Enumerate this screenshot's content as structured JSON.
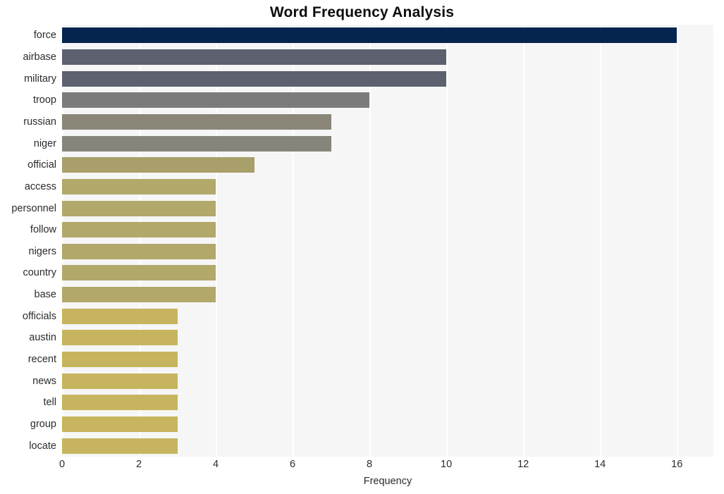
{
  "chart_data": {
    "type": "bar",
    "orientation": "horizontal",
    "title": "Word Frequency Analysis",
    "xlabel": "Frequency",
    "ylabel": "",
    "categories": [
      "force",
      "airbase",
      "military",
      "troop",
      "russian",
      "niger",
      "official",
      "access",
      "personnel",
      "follow",
      "nigers",
      "country",
      "base",
      "officials",
      "austin",
      "recent",
      "news",
      "tell",
      "group",
      "locate"
    ],
    "values": [
      16,
      10,
      10,
      8,
      7,
      7,
      5,
      4,
      4,
      4,
      4,
      4,
      4,
      3,
      3,
      3,
      3,
      3,
      3,
      3
    ],
    "bar_colors": [
      "#05254f",
      "#5d606e",
      "#5d606e",
      "#7b7b7b",
      "#8b8778",
      "#87847a",
      "#a89f6b",
      "#b2a86a",
      "#b2a86a",
      "#b2a86a",
      "#b2a86a",
      "#b2a86a",
      "#b2a86a",
      "#c6b55e",
      "#c6b55e",
      "#c6b55e",
      "#c6b55e",
      "#c6b55e",
      "#c6b55e",
      "#c6b55e"
    ],
    "xlim": [
      0,
      16.95
    ],
    "xticks": [
      0,
      2,
      4,
      6,
      8,
      10,
      12,
      14,
      16
    ],
    "xtick_labels": [
      "0",
      "2",
      "4",
      "6",
      "8",
      "10",
      "12",
      "14",
      "16"
    ],
    "grid": "vertical-white-on-light-gray",
    "legend": "none",
    "plot_background": "#f6f6f7",
    "figure_background": "#ffffff",
    "title_color": "#0d0d0d",
    "tick_color": "#2b2b2b"
  }
}
